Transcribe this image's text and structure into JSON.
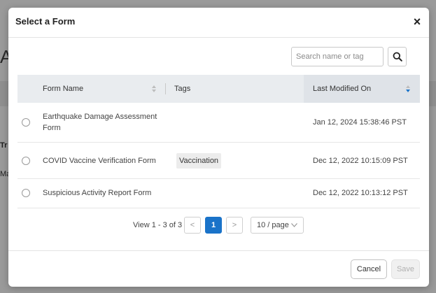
{
  "background": {
    "title_fragment": "Ar",
    "text_tr": "Tr",
    "text_man": "Man"
  },
  "modal": {
    "title": "Select a Form",
    "close_label": "×"
  },
  "search": {
    "placeholder": "Search name or tag",
    "value": ""
  },
  "table": {
    "columns": {
      "name": "Form Name",
      "tags": "Tags",
      "modified": "Last Modified On"
    },
    "rows": [
      {
        "name": "Earthquake Damage Assessment Form",
        "tag": "",
        "modified": "Jan 12, 2024 15:38:46 PST"
      },
      {
        "name": "COVID Vaccine Verification Form",
        "tag": "Vaccination",
        "modified": "Dec 12, 2022 10:15:09 PST"
      },
      {
        "name": "Suspicious Activity Report Form",
        "tag": "",
        "modified": "Dec 12, 2022 10:13:12 PST"
      }
    ]
  },
  "pagination": {
    "view_text": "View 1 - 3 of 3",
    "prev_label": "<",
    "current_page": "1",
    "next_label": ">",
    "page_size": "10 / page"
  },
  "footer": {
    "cancel_label": "Cancel",
    "save_label": "Save"
  },
  "colors": {
    "accent": "#1a73c9",
    "overlay": "#9b9b9b"
  }
}
